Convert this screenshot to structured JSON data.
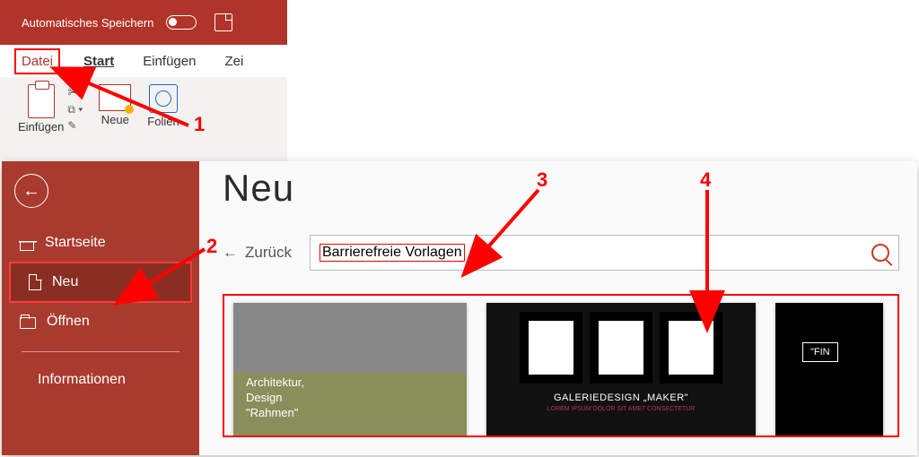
{
  "titlebar": {
    "autosave": "Automatisches Speichern"
  },
  "tabs": {
    "datei": "Datei",
    "start": "Start",
    "einfuegen": "Einfügen",
    "zei": "Zei"
  },
  "ribbon": {
    "einfuegen": "Einfügen",
    "neue": "Neue",
    "folien": "Folien"
  },
  "sidebar": {
    "startseite": "Startseite",
    "neu": "Neu",
    "oeffnen": "Öffnen",
    "informationen": "Informationen"
  },
  "main": {
    "title": "Neu",
    "back": "Zurück",
    "search": "Barrierefreie Vorlagen"
  },
  "templates": {
    "card1_l1": "Architektur,",
    "card1_l2": "Design",
    "card1_l3": "\"Rahmen\"",
    "card2_label": "GALERIEDESIGN „MAKER\"",
    "card3_label": "\"FIN"
  },
  "anno": {
    "n1": "1",
    "n2": "2",
    "n3": "3",
    "n4": "4"
  }
}
